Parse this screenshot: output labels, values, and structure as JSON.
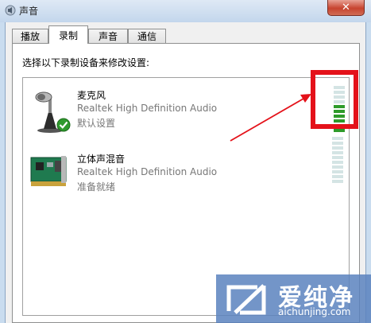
{
  "window": {
    "title": "声音",
    "close_label": "✕"
  },
  "tabs": [
    {
      "label": "播放",
      "active": false
    },
    {
      "label": "录制",
      "active": true
    },
    {
      "label": "声音",
      "active": false
    },
    {
      "label": "通信",
      "active": false
    }
  ],
  "instruction": "选择以下录制设备来修改设置:",
  "devices": [
    {
      "name": "麦克风",
      "description": "Realtek High Definition Audio",
      "status": "默认设置",
      "icon": "microphone-icon",
      "default": true,
      "level": 0.6
    },
    {
      "name": "立体声混音",
      "description": "Realtek High Definition Audio",
      "status": "准备就绪",
      "icon": "sound-card-icon",
      "default": false,
      "level": 0
    }
  ],
  "watermark": {
    "text": "爱纯净",
    "url": "aichunjing.com"
  },
  "colors": {
    "meter_on": "#2e9b2a",
    "meter_off": "#d4e4e4",
    "highlight": "#e4121a"
  }
}
